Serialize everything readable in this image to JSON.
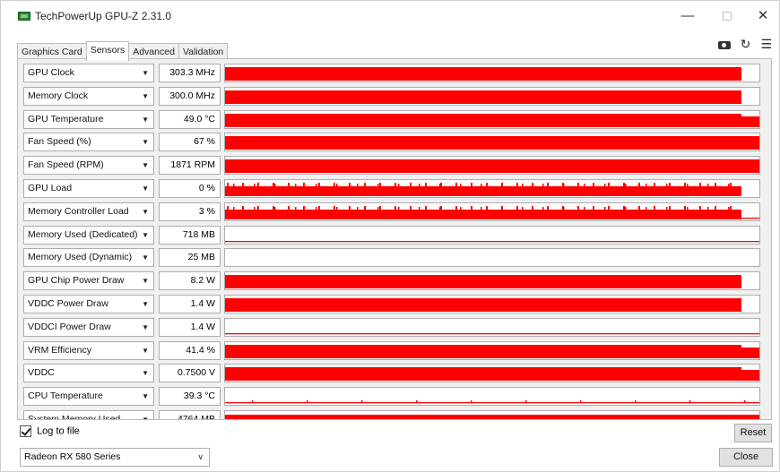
{
  "window": {
    "title": "TechPowerUp GPU-Z 2.31.0",
    "minimize": "—",
    "close": "✕"
  },
  "tabs": [
    {
      "label": "Graphics Card",
      "active": false
    },
    {
      "label": "Sensors",
      "active": true
    },
    {
      "label": "Advanced",
      "active": false
    },
    {
      "label": "Validation",
      "active": false
    }
  ],
  "toolbar": {
    "camera_icon": "camera-icon",
    "refresh_icon": "refresh-icon",
    "menu_icon": "menu-icon",
    "refresh_glyph": "↻",
    "menu_glyph": "☰"
  },
  "colors": {
    "graph": "#ff0000",
    "accent": "#ff0000"
  },
  "dropdown_arrow": "▼",
  "sensors": [
    {
      "name": "GPU Clock",
      "value": "303.3 MHz",
      "pattern": "full"
    },
    {
      "name": "Memory Clock",
      "value": "300.0 MHz",
      "pattern": "full"
    },
    {
      "name": "GPU Temperature",
      "value": "49.0 °C",
      "pattern": "fullstep"
    },
    {
      "name": "Fan Speed (%)",
      "value": "67 %",
      "pattern": "fullall"
    },
    {
      "name": "Fan Speed (RPM)",
      "value": "1871 RPM",
      "pattern": "fullall"
    },
    {
      "name": "GPU Load",
      "value": "0 %",
      "pattern": "comb"
    },
    {
      "name": "Memory Controller Load",
      "value": "3 %",
      "pattern": "comb2"
    },
    {
      "name": "Memory Used (Dedicated)",
      "value": "718 MB",
      "pattern": "line"
    },
    {
      "name": "Memory Used (Dynamic)",
      "value": "25 MB",
      "pattern": "empty"
    },
    {
      "name": "GPU Chip Power Draw",
      "value": "8.2 W",
      "pattern": "full"
    },
    {
      "name": "VDDC Power Draw",
      "value": "1.4 W",
      "pattern": "full"
    },
    {
      "name": "VDDCI Power Draw",
      "value": "1.4 W",
      "pattern": "line"
    },
    {
      "name": "VRM Efficiency",
      "value": "41.4 %",
      "pattern": "fullstep"
    },
    {
      "name": "VDDC",
      "value": "0.7500 V",
      "pattern": "fullstep"
    },
    {
      "name": "CPU Temperature",
      "value": "39.3 °C",
      "pattern": "lowline"
    },
    {
      "name": "System Memory Used",
      "value": "4764 MB",
      "pattern": "partial"
    }
  ],
  "bottom": {
    "log_to_file": "Log to file",
    "log_checked": true,
    "reset": "Reset",
    "gpu_select": "Radeon RX 580 Series",
    "gpu_arrow": "∨",
    "close": "Close"
  }
}
